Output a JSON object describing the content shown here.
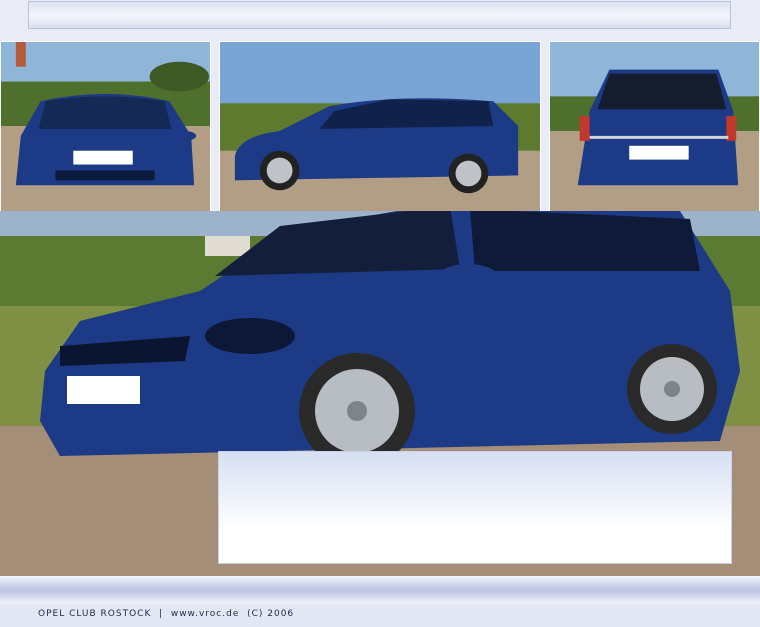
{
  "footer": {
    "text": "OPEL CLUB ROSTOCK  |  www.vroc.de  (C) 2006"
  },
  "photos": {
    "front": "front-view-photo",
    "side": "side-view-photo",
    "rear": "rear-view-photo",
    "main": "three-quarter-view-photo"
  },
  "colors": {
    "car_blue": "#1d3a86",
    "sky": "#7da6d6",
    "ground": "#a6907a",
    "grass": "#6f8a3a"
  }
}
